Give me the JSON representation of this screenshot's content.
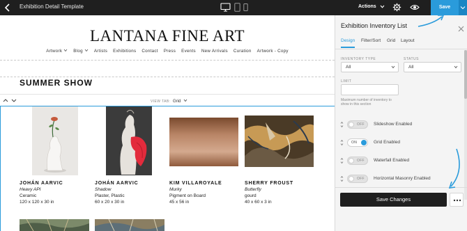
{
  "topbar": {
    "title": "Exhibition Detail Template",
    "actions_label": "Actions",
    "save_label": "Save",
    "icons": [
      "back-chevron-icon",
      "desktop-icon",
      "tablet-icon",
      "mobile-icon",
      "chevron-down-icon",
      "gear-icon",
      "eye-icon"
    ]
  },
  "site": {
    "logo": "LANTANA FINE ART",
    "nav": [
      "Artwork",
      "Blog",
      "Artists",
      "Exhibitions",
      "Contact",
      "Press",
      "Events",
      "New Arrivals",
      "Curation",
      "Artwork - Copy"
    ],
    "nav_dropdowns": [
      "Artwork",
      "Blog"
    ]
  },
  "section": {
    "title": "SUMMER SHOW",
    "view_tab_label": "VIEW TAB:",
    "view_tab_value": "Grid"
  },
  "artworks": [
    {
      "artist": "JOHÁN AARVIC",
      "title": "Heavy API",
      "medium": "Ceramic",
      "dims": "120 x 120 x 30 in"
    },
    {
      "artist": "JOHÁN AARVIC",
      "title": "Shadow",
      "medium": "Plaster, Plastic",
      "dims": "60 x 20 x 30 in"
    },
    {
      "artist": "KIM VILLAROYALE",
      "title": "Murky",
      "medium": "Pigment on Board",
      "dims": "45 x 56 in"
    },
    {
      "artist": "SHERRY FROUST",
      "title": "Butterfly",
      "medium": "gourd",
      "dims": "40 x 60 x 3 in"
    }
  ],
  "panel": {
    "title": "Exhibition Inventory List",
    "tabs": [
      "Design",
      "Filter/Sort",
      "Grid",
      "Layout"
    ],
    "active_tab": "Design",
    "inventory_type_label": "INVENTORY TYPE",
    "inventory_type_value": "All",
    "status_label": "STATUS",
    "status_value": "All",
    "limit_label": "LIMIT",
    "limit_value": "",
    "limit_help": "Maximum number of inventory to show in this section",
    "toggles": [
      {
        "state": "OFF",
        "label": "Slideshow Enabled"
      },
      {
        "state": "ON",
        "label": "Grid Enabled"
      },
      {
        "state": "OFF",
        "label": "Waterfall Enabled"
      },
      {
        "state": "OFF",
        "label": "Horizontal Masonry Enabled"
      }
    ],
    "save_changes_label": "Save Changes"
  },
  "colors": {
    "accent": "#2a9bdb",
    "topbar": "#1f1f1f",
    "panel_bg": "#f4f4f4"
  }
}
